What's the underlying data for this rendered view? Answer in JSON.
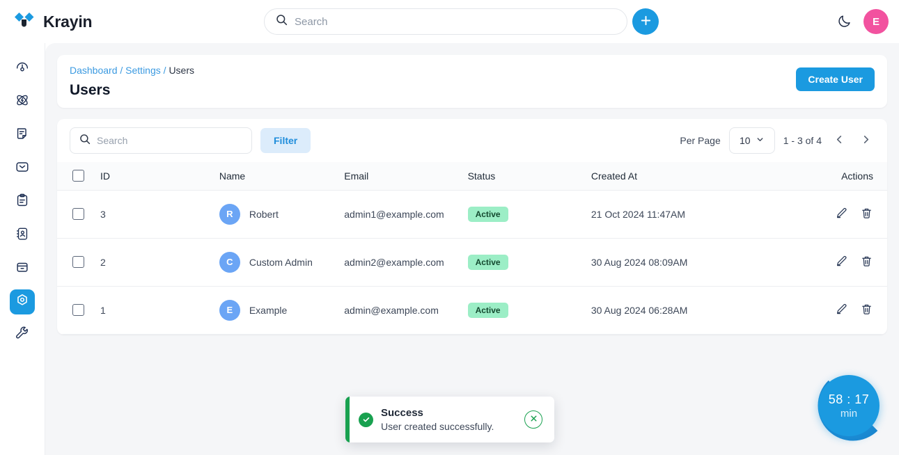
{
  "app": {
    "brand_name": "Krayin",
    "logo_icon": "krayin-diamond-logo"
  },
  "topbar": {
    "search_placeholder": "Search",
    "search_icon": "search-icon",
    "add_icon": "plus-icon",
    "theme_toggle_icon": "moon-icon",
    "avatar_initial": "E",
    "avatar_color": "#f2529f"
  },
  "sidebar": {
    "items": [
      {
        "name": "dashboard",
        "icon": "gauge-icon",
        "active": false
      },
      {
        "name": "leads",
        "icon": "atom-icon",
        "active": false
      },
      {
        "name": "quotes",
        "icon": "note-icon",
        "active": false
      },
      {
        "name": "mail",
        "icon": "mail-icon",
        "active": false
      },
      {
        "name": "activities",
        "icon": "clipboard-icon",
        "active": false
      },
      {
        "name": "contacts",
        "icon": "address-book-icon",
        "active": false
      },
      {
        "name": "products",
        "icon": "box-icon",
        "active": false
      },
      {
        "name": "settings",
        "icon": "settings-hex-icon",
        "active": true
      },
      {
        "name": "configuration",
        "icon": "wrench-icon",
        "active": false
      }
    ]
  },
  "header": {
    "breadcrumb": {
      "items": [
        "Dashboard",
        "Settings",
        "Users"
      ],
      "separator": "/"
    },
    "title": "Users",
    "create_button_label": "Create User",
    "accent_color": "#1b9ae0"
  },
  "toolbar": {
    "search_placeholder": "Search",
    "search_icon": "search-icon",
    "filter_label": "Filter",
    "per_page_label": "Per Page",
    "per_page_value": "10",
    "per_page_chevron": "chevron-down-icon",
    "range_label": "1 - 3 of 4",
    "prev_icon": "chevron-left-icon",
    "next_icon": "chevron-right-icon"
  },
  "table": {
    "columns": [
      "",
      "ID",
      "Name",
      "Email",
      "Status",
      "Created At",
      "Actions"
    ],
    "rows": [
      {
        "id": "3",
        "avatar": "R",
        "name": "Robert",
        "email": "admin1@example.com",
        "status": "Active",
        "created_at": "21 Oct 2024 11:47AM",
        "edit_icon": "pencil-icon",
        "delete_icon": "trash-icon"
      },
      {
        "id": "2",
        "avatar": "C",
        "name": "Custom Admin",
        "email": "admin2@example.com",
        "status": "Active",
        "created_at": "30 Aug 2024 08:09AM",
        "edit_icon": "pencil-icon",
        "delete_icon": "trash-icon"
      },
      {
        "id": "1",
        "avatar": "E",
        "name": "Example",
        "email": "admin@example.com",
        "status": "Active",
        "created_at": "30 Aug 2024 06:28AM",
        "edit_icon": "pencil-icon",
        "delete_icon": "trash-icon"
      }
    ],
    "status_badge_color": "#9ceec6",
    "avatar_color": "#6ba5f5"
  },
  "toast": {
    "title": "Success",
    "message": "User created successfully.",
    "check_icon": "check-circle-icon",
    "close_icon": "close-icon",
    "color": "#19a150"
  },
  "timer": {
    "time": "58 : 17",
    "unit": "min",
    "color": "#1b9ae0"
  }
}
